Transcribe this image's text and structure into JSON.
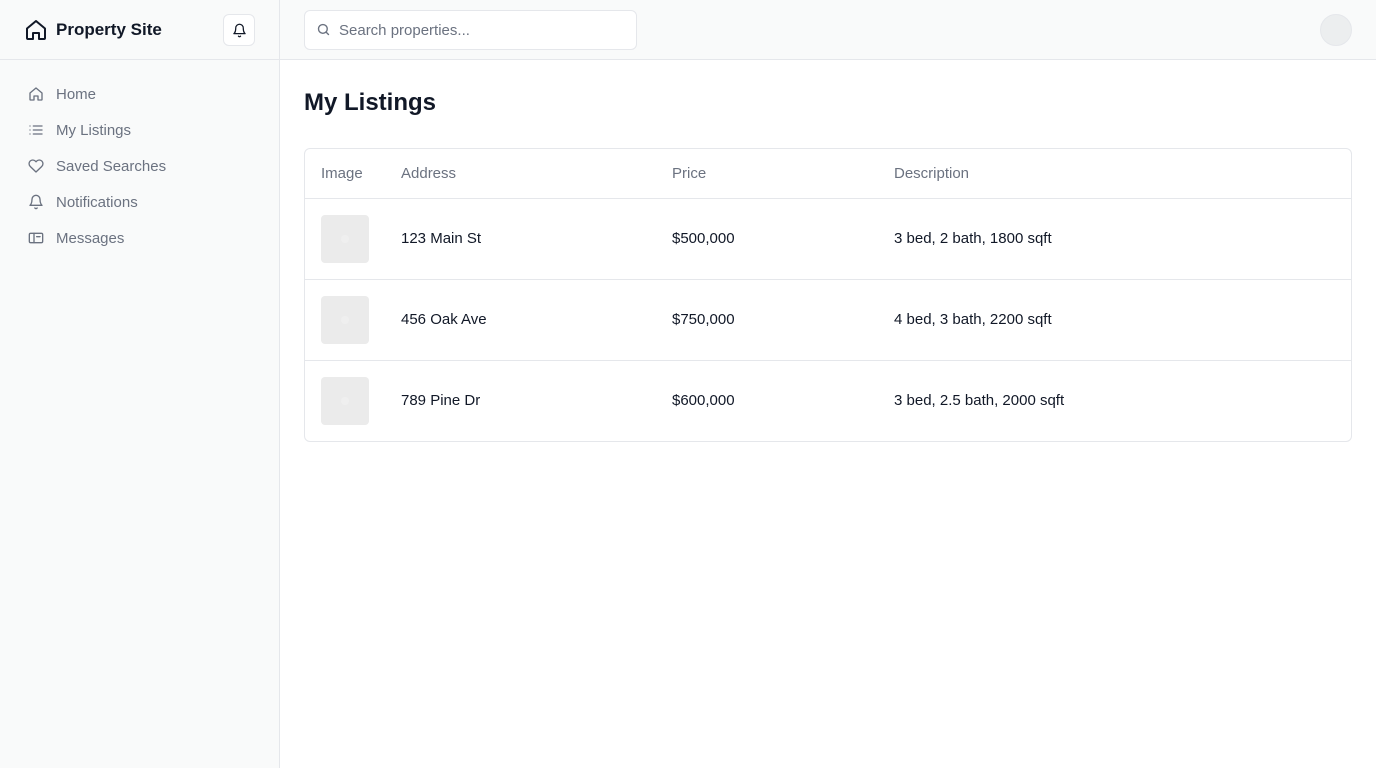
{
  "app": {
    "title": "Property Site",
    "brand_icon": "home-icon",
    "notification_icon": "bell-icon"
  },
  "sidebar": {
    "items": [
      {
        "label": "Home",
        "icon": "home-icon"
      },
      {
        "label": "My Listings",
        "icon": "list-icon"
      },
      {
        "label": "Saved Searches",
        "icon": "heart-icon"
      },
      {
        "label": "Notifications",
        "icon": "bell-icon"
      },
      {
        "label": "Messages",
        "icon": "message-icon"
      }
    ]
  },
  "search": {
    "placeholder": "Search properties...",
    "value": "",
    "icon": "search-icon"
  },
  "main": {
    "title": "My Listings",
    "table": {
      "columns": [
        "Image",
        "Address",
        "Price",
        "Description"
      ],
      "rows": [
        {
          "address": "123 Main St",
          "price": "$500,000",
          "description": "3 bed, 2 bath, 1800 sqft"
        },
        {
          "address": "456 Oak Ave",
          "price": "$750,000",
          "description": "4 bed, 3 bath, 2200 sqft"
        },
        {
          "address": "789 Pine Dr",
          "price": "$600,000",
          "description": "3 bed, 2.5 bath, 2000 sqft"
        }
      ]
    }
  },
  "colors": {
    "sidebar_bg": "#f9fafa",
    "border": "#e5e7eb",
    "muted_text": "#6b7280",
    "text": "#111827",
    "thumb_placeholder": "#ebebeb"
  }
}
